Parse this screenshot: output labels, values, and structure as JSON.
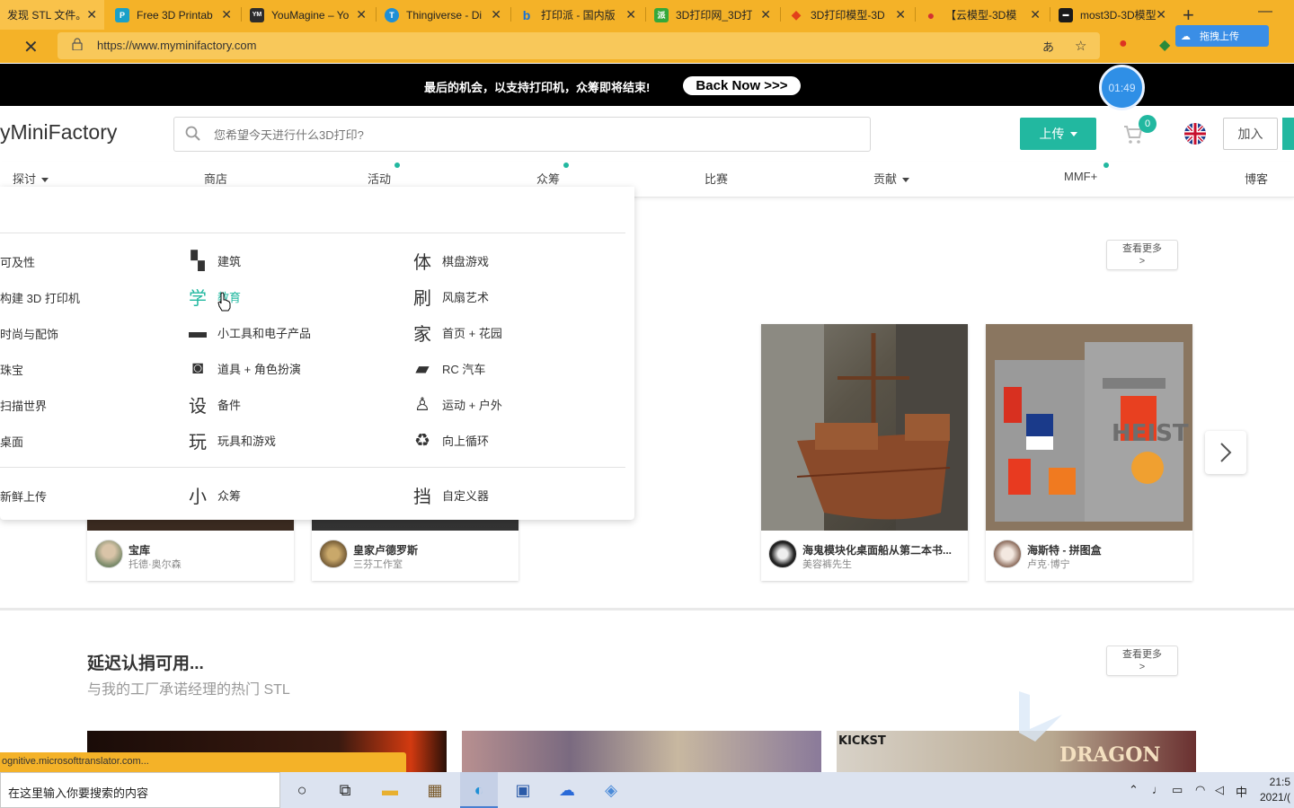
{
  "browser": {
    "tabs": [
      {
        "title": "发现 STL 文件。",
        "fav_color": "#f4b228",
        "fav": ""
      },
      {
        "title": "Free 3D Printab",
        "fav_color": "#1aa0c8",
        "fav": "P"
      },
      {
        "title": "YouMagine – Yo",
        "fav_color": "#2c2c2c",
        "fav": "YM"
      },
      {
        "title": "Thingiverse - Di",
        "fav_color": "#1e8fd6",
        "fav": "T"
      },
      {
        "title": "打印派 - 国内版",
        "fav_color": "#1470d8",
        "fav": "b"
      },
      {
        "title": "3D打印网_3D打",
        "fav_color": "#34a83a",
        "fav": "派"
      },
      {
        "title": "3D打印模型-3D",
        "fav_color": "#e2401a",
        "fav": "◆"
      },
      {
        "title": "【云模型-3D模",
        "fav_color": "#d23232",
        "fav": "●"
      },
      {
        "title": "most3D-3D模型",
        "fav_color": "#1a1a1a",
        "fav": "▬"
      }
    ],
    "new_tab": "+",
    "minimize": "—",
    "url": "https://www.myminifactory.com",
    "drag_upload": "拖拽上传",
    "status_url": "ognitive.microsofttranslator.com..."
  },
  "promo": {
    "message": "最后的机会，以支持打印机，众筹即将结束!",
    "button": "Back Now >>>",
    "timer": "01:49"
  },
  "header": {
    "logo": "yMiniFactory",
    "search_placeholder": "您希望今天进行什么3D打印?",
    "upload": "上传",
    "cart_count": "0",
    "join": "加入"
  },
  "nav": {
    "items": [
      {
        "label": "探讨",
        "caret": true
      },
      {
        "label": "商店"
      },
      {
        "label": "活动",
        "dot": true
      },
      {
        "label": "众筹",
        "dot": true
      },
      {
        "label": "比赛"
      },
      {
        "label": "贡献",
        "caret": true
      },
      {
        "label": "MMF+",
        "dot": true
      },
      {
        "label": "博客"
      }
    ]
  },
  "dropdown": {
    "col1": [
      "可及性",
      "构建 3D 打印机",
      "时尚与配饰",
      "珠宝",
      "扫描世界",
      "桌面"
    ],
    "col2": [
      {
        "icon": "ruler-icon",
        "glyph": "▚",
        "label": "建筑"
      },
      {
        "icon": "education-icon",
        "glyph": "学",
        "label": "教育",
        "highlight": true
      },
      {
        "icon": "gamepad-icon",
        "glyph": "▬",
        "label": "小工具和电子产品"
      },
      {
        "icon": "mask-icon",
        "glyph": "◙",
        "label": "道具 + 角色扮演"
      },
      {
        "icon": "spare-parts-icon",
        "glyph": "设",
        "label": "备件"
      },
      {
        "icon": "toy-icon",
        "glyph": "玩",
        "label": "玩具和游戏"
      }
    ],
    "col3": [
      {
        "icon": "board-game-icon",
        "glyph": "体",
        "label": "棋盘游戏"
      },
      {
        "icon": "fan-art-icon",
        "glyph": "刷",
        "label": "风扇艺术"
      },
      {
        "icon": "home-icon",
        "glyph": "家",
        "label": "首页 + 花园"
      },
      {
        "icon": "car-icon",
        "glyph": "▰",
        "label": "RC 汽车"
      },
      {
        "icon": "hiking-icon",
        "glyph": "♙",
        "label": "运动 + 户外"
      },
      {
        "icon": "recycle-icon",
        "glyph": "♻",
        "label": "向上循环"
      }
    ],
    "bottom": [
      {
        "label": "新鲜上传"
      },
      {
        "icon": "small-icon",
        "glyph": "小",
        "label": "众筹"
      },
      {
        "icon": "customizer-icon",
        "glyph": "挡",
        "label": "自定义器"
      }
    ]
  },
  "section1": {
    "see_more": "查看更多",
    "see_more_arrow": ">",
    "cards": [
      {
        "title": "宝库",
        "author": "托德·奥尔森"
      },
      {
        "title": "皇家卢德罗斯",
        "author": "三芬工作室"
      },
      {
        "title": "海鬼模块化桌面船从第二本书...",
        "author": "美容裤先生"
      },
      {
        "title": "海斯特 - 拼图盒",
        "author": "卢克·博宁"
      }
    ]
  },
  "section2": {
    "title": "延迟认捐可用...",
    "subtitle": "与我的工厂承诺经理的热门 STL",
    "see_more": "查看更多",
    "see_more_arrow": ">",
    "image_text_1": "KICKST",
    "image_text_2": "DRAGON"
  },
  "taskbar": {
    "search": "在这里输入你要搜索的内容",
    "ime": "中",
    "time": "21:5",
    "date": "2021/("
  }
}
